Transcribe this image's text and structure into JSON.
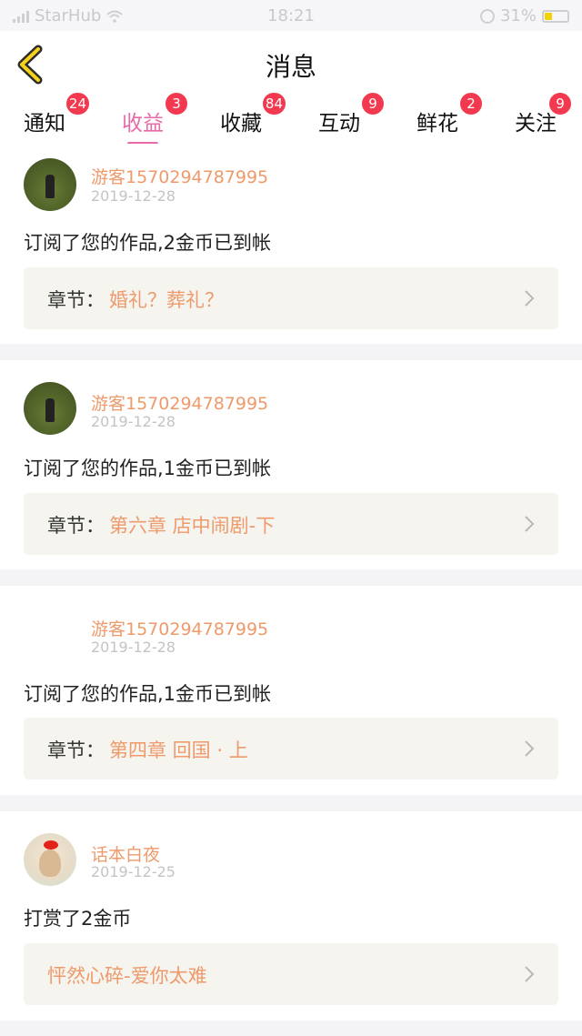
{
  "status": {
    "carrier": "StarHub",
    "time": "18:21",
    "battery": "31%"
  },
  "nav": {
    "title": "消息"
  },
  "tabs": [
    {
      "label": "通知",
      "badge": "24"
    },
    {
      "label": "收益",
      "badge": "3"
    },
    {
      "label": "收藏",
      "badge": "84"
    },
    {
      "label": "互动",
      "badge": "9"
    },
    {
      "label": "鲜花",
      "badge": "2"
    },
    {
      "label": "关注",
      "badge": "9"
    }
  ],
  "messages": [
    {
      "user": "游客1570294787995",
      "date": "2019-12-28",
      "text": "订阅了您的作品,2金币已到帐",
      "chapter_label": "章节：",
      "chapter": "婚礼？葬礼？"
    },
    {
      "user": "游客1570294787995",
      "date": "2019-12-28",
      "text": "订阅了您的作品,1金币已到帐",
      "chapter_label": "章节：",
      "chapter": "第六章 店中闹剧-下"
    },
    {
      "user": "游客1570294787995",
      "date": "2019-12-28",
      "text": "订阅了您的作品,1金币已到帐",
      "chapter_label": "章节：",
      "chapter": "第四章 回国 · 上"
    },
    {
      "user": "话本白夜",
      "date": "2019-12-25",
      "text": "打赏了2金币",
      "chapter": "怦然心碎-爱你太难"
    }
  ],
  "colors": {
    "accent_pink": "#e86aa8",
    "accent_orange": "#ee9a6b",
    "badge_red": "#f2394f"
  }
}
